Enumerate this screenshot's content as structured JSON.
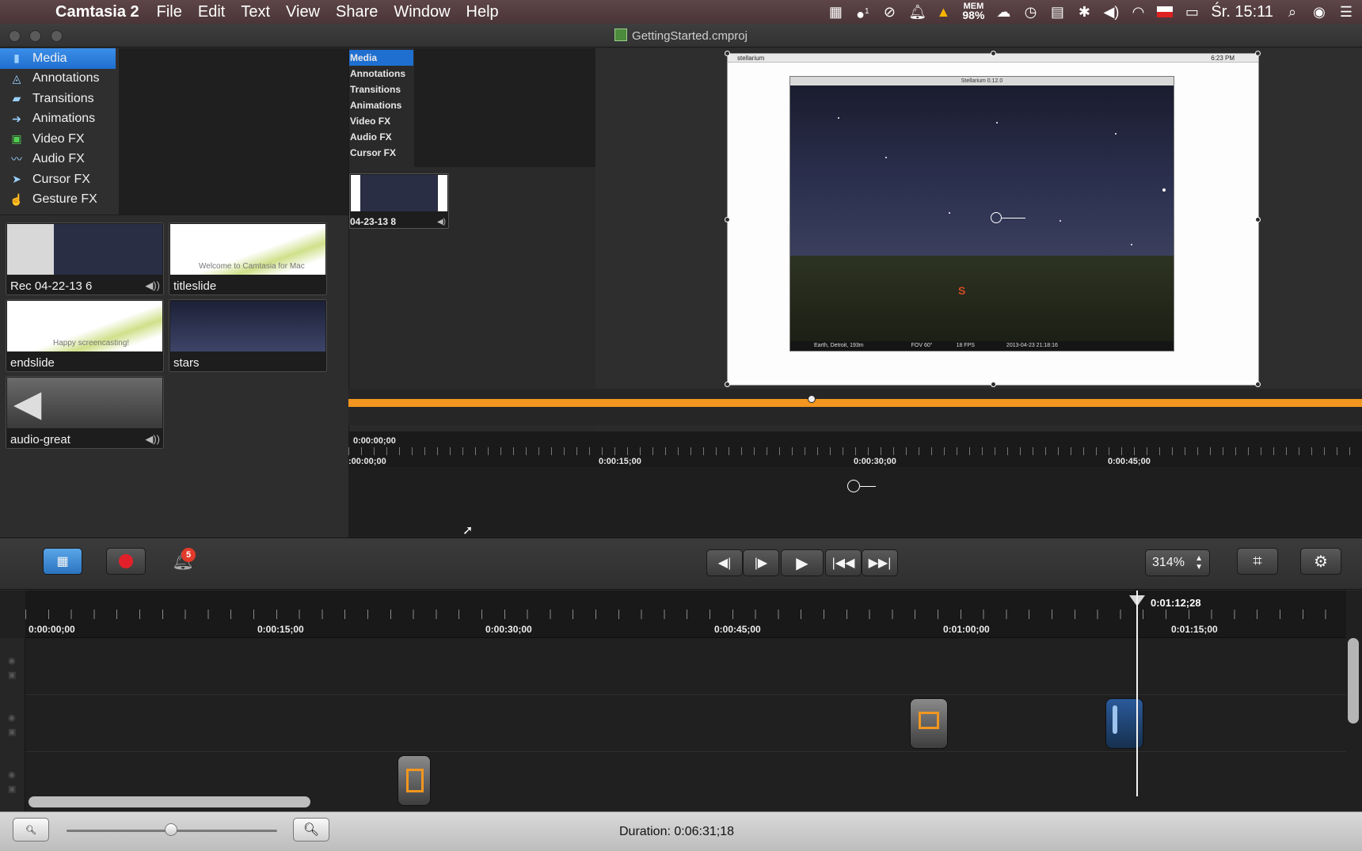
{
  "menubar": {
    "app_name": "Camtasia 2",
    "menus": [
      "File",
      "Edit",
      "Text",
      "View",
      "Share",
      "Window",
      "Help"
    ],
    "mem_label": "MEM",
    "mem_value": "98%",
    "notification_count": "1",
    "clock": "Śr. 15:11"
  },
  "window": {
    "title": "GettingStarted.cmproj"
  },
  "sidebar": {
    "items": [
      {
        "label": "Media",
        "icon": "film-icon"
      },
      {
        "label": "Annotations",
        "icon": "annotation-icon"
      },
      {
        "label": "Transitions",
        "icon": "transition-icon"
      },
      {
        "label": "Animations",
        "icon": "animation-icon"
      },
      {
        "label": "Video FX",
        "icon": "video-fx-icon"
      },
      {
        "label": "Audio FX",
        "icon": "audio-fx-icon"
      },
      {
        "label": "Cursor FX",
        "icon": "cursor-icon"
      },
      {
        "label": "Gesture FX",
        "icon": "gesture-icon"
      }
    ]
  },
  "media_bin": {
    "clips": [
      {
        "label": "Rec 04-22-13 6"
      },
      {
        "label": "titleslide",
        "thumb_text": "Welcome to Camtasia for Mac"
      },
      {
        "label": "endslide",
        "thumb_text": "Happy screencasting!"
      },
      {
        "label": "stars"
      },
      {
        "label": "audio-great"
      }
    ]
  },
  "mini_panel": {
    "items": [
      "Media",
      "Annotations",
      "Transitions",
      "Animations",
      "Video FX",
      "Audio FX",
      "Cursor FX"
    ],
    "clip_label": "04-23-13 8"
  },
  "canvas": {
    "menu_app": "stellarium",
    "menu_clock": "6:23 PM",
    "window_title": "Stellarium 0.12.0",
    "compass": "S",
    "status_location": "Earth, Detroit, 193m",
    "status_fov": "FOV 60°",
    "status_fps": "18 FPS",
    "status_datetime": "2013-04-23   21:18:16"
  },
  "inner_timeline": {
    "current": "0:00:00;00",
    "ticks": [
      ":00:00;00",
      "0:00:15;00",
      "0:00:30;00",
      "0:00:45;00"
    ]
  },
  "controls": {
    "record_badge": "5",
    "zoom": "314%"
  },
  "timeline": {
    "ticks": [
      "0:00:00;00",
      "0:00:15;00",
      "0:00:30;00",
      "0:00:45;00",
      "0:01:00;00",
      "0:01:15;00"
    ],
    "playhead": "0:01:12;28"
  },
  "footer": {
    "duration": "Duration: 0:06:31;18"
  }
}
